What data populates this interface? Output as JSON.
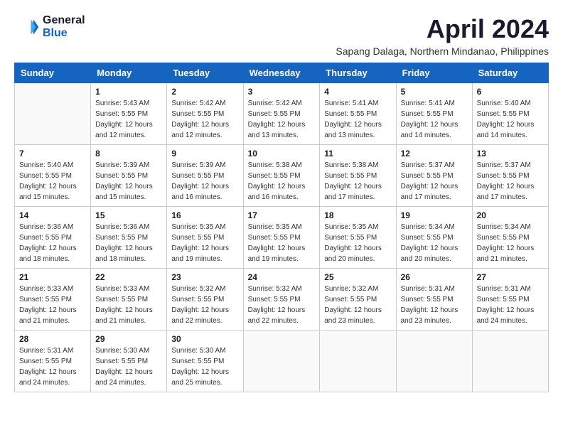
{
  "logo": {
    "text_general": "General",
    "text_blue": "Blue"
  },
  "title": "April 2024",
  "subtitle": "Sapang Dalaga, Northern Mindanao, Philippines",
  "days_of_week": [
    "Sunday",
    "Monday",
    "Tuesday",
    "Wednesday",
    "Thursday",
    "Friday",
    "Saturday"
  ],
  "weeks": [
    [
      {
        "day": "",
        "sunrise": "",
        "sunset": "",
        "daylight": ""
      },
      {
        "day": "1",
        "sunrise": "Sunrise: 5:43 AM",
        "sunset": "Sunset: 5:55 PM",
        "daylight": "Daylight: 12 hours and 12 minutes."
      },
      {
        "day": "2",
        "sunrise": "Sunrise: 5:42 AM",
        "sunset": "Sunset: 5:55 PM",
        "daylight": "Daylight: 12 hours and 12 minutes."
      },
      {
        "day": "3",
        "sunrise": "Sunrise: 5:42 AM",
        "sunset": "Sunset: 5:55 PM",
        "daylight": "Daylight: 12 hours and 13 minutes."
      },
      {
        "day": "4",
        "sunrise": "Sunrise: 5:41 AM",
        "sunset": "Sunset: 5:55 PM",
        "daylight": "Daylight: 12 hours and 13 minutes."
      },
      {
        "day": "5",
        "sunrise": "Sunrise: 5:41 AM",
        "sunset": "Sunset: 5:55 PM",
        "daylight": "Daylight: 12 hours and 14 minutes."
      },
      {
        "day": "6",
        "sunrise": "Sunrise: 5:40 AM",
        "sunset": "Sunset: 5:55 PM",
        "daylight": "Daylight: 12 hours and 14 minutes."
      }
    ],
    [
      {
        "day": "7",
        "sunrise": "Sunrise: 5:40 AM",
        "sunset": "Sunset: 5:55 PM",
        "daylight": "Daylight: 12 hours and 15 minutes."
      },
      {
        "day": "8",
        "sunrise": "Sunrise: 5:39 AM",
        "sunset": "Sunset: 5:55 PM",
        "daylight": "Daylight: 12 hours and 15 minutes."
      },
      {
        "day": "9",
        "sunrise": "Sunrise: 5:39 AM",
        "sunset": "Sunset: 5:55 PM",
        "daylight": "Daylight: 12 hours and 16 minutes."
      },
      {
        "day": "10",
        "sunrise": "Sunrise: 5:38 AM",
        "sunset": "Sunset: 5:55 PM",
        "daylight": "Daylight: 12 hours and 16 minutes."
      },
      {
        "day": "11",
        "sunrise": "Sunrise: 5:38 AM",
        "sunset": "Sunset: 5:55 PM",
        "daylight": "Daylight: 12 hours and 17 minutes."
      },
      {
        "day": "12",
        "sunrise": "Sunrise: 5:37 AM",
        "sunset": "Sunset: 5:55 PM",
        "daylight": "Daylight: 12 hours and 17 minutes."
      },
      {
        "day": "13",
        "sunrise": "Sunrise: 5:37 AM",
        "sunset": "Sunset: 5:55 PM",
        "daylight": "Daylight: 12 hours and 17 minutes."
      }
    ],
    [
      {
        "day": "14",
        "sunrise": "Sunrise: 5:36 AM",
        "sunset": "Sunset: 5:55 PM",
        "daylight": "Daylight: 12 hours and 18 minutes."
      },
      {
        "day": "15",
        "sunrise": "Sunrise: 5:36 AM",
        "sunset": "Sunset: 5:55 PM",
        "daylight": "Daylight: 12 hours and 18 minutes."
      },
      {
        "day": "16",
        "sunrise": "Sunrise: 5:35 AM",
        "sunset": "Sunset: 5:55 PM",
        "daylight": "Daylight: 12 hours and 19 minutes."
      },
      {
        "day": "17",
        "sunrise": "Sunrise: 5:35 AM",
        "sunset": "Sunset: 5:55 PM",
        "daylight": "Daylight: 12 hours and 19 minutes."
      },
      {
        "day": "18",
        "sunrise": "Sunrise: 5:35 AM",
        "sunset": "Sunset: 5:55 PM",
        "daylight": "Daylight: 12 hours and 20 minutes."
      },
      {
        "day": "19",
        "sunrise": "Sunrise: 5:34 AM",
        "sunset": "Sunset: 5:55 PM",
        "daylight": "Daylight: 12 hours and 20 minutes."
      },
      {
        "day": "20",
        "sunrise": "Sunrise: 5:34 AM",
        "sunset": "Sunset: 5:55 PM",
        "daylight": "Daylight: 12 hours and 21 minutes."
      }
    ],
    [
      {
        "day": "21",
        "sunrise": "Sunrise: 5:33 AM",
        "sunset": "Sunset: 5:55 PM",
        "daylight": "Daylight: 12 hours and 21 minutes."
      },
      {
        "day": "22",
        "sunrise": "Sunrise: 5:33 AM",
        "sunset": "Sunset: 5:55 PM",
        "daylight": "Daylight: 12 hours and 21 minutes."
      },
      {
        "day": "23",
        "sunrise": "Sunrise: 5:32 AM",
        "sunset": "Sunset: 5:55 PM",
        "daylight": "Daylight: 12 hours and 22 minutes."
      },
      {
        "day": "24",
        "sunrise": "Sunrise: 5:32 AM",
        "sunset": "Sunset: 5:55 PM",
        "daylight": "Daylight: 12 hours and 22 minutes."
      },
      {
        "day": "25",
        "sunrise": "Sunrise: 5:32 AM",
        "sunset": "Sunset: 5:55 PM",
        "daylight": "Daylight: 12 hours and 23 minutes."
      },
      {
        "day": "26",
        "sunrise": "Sunrise: 5:31 AM",
        "sunset": "Sunset: 5:55 PM",
        "daylight": "Daylight: 12 hours and 23 minutes."
      },
      {
        "day": "27",
        "sunrise": "Sunrise: 5:31 AM",
        "sunset": "Sunset: 5:55 PM",
        "daylight": "Daylight: 12 hours and 24 minutes."
      }
    ],
    [
      {
        "day": "28",
        "sunrise": "Sunrise: 5:31 AM",
        "sunset": "Sunset: 5:55 PM",
        "daylight": "Daylight: 12 hours and 24 minutes."
      },
      {
        "day": "29",
        "sunrise": "Sunrise: 5:30 AM",
        "sunset": "Sunset: 5:55 PM",
        "daylight": "Daylight: 12 hours and 24 minutes."
      },
      {
        "day": "30",
        "sunrise": "Sunrise: 5:30 AM",
        "sunset": "Sunset: 5:55 PM",
        "daylight": "Daylight: 12 hours and 25 minutes."
      },
      {
        "day": "",
        "sunrise": "",
        "sunset": "",
        "daylight": ""
      },
      {
        "day": "",
        "sunrise": "",
        "sunset": "",
        "daylight": ""
      },
      {
        "day": "",
        "sunrise": "",
        "sunset": "",
        "daylight": ""
      },
      {
        "day": "",
        "sunrise": "",
        "sunset": "",
        "daylight": ""
      }
    ]
  ]
}
